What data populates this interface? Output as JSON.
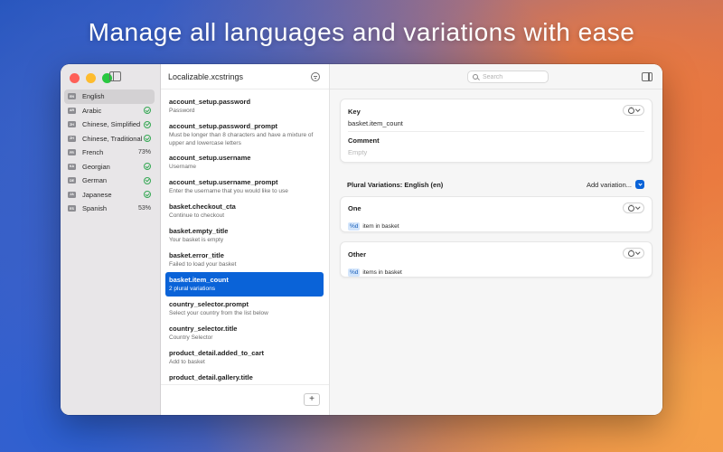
{
  "headline": "Manage all languages and variations with ease",
  "sidebar": {
    "languages": [
      {
        "code": "EN",
        "name": "English",
        "status": "",
        "complete": false,
        "selected": true
      },
      {
        "code": "AR",
        "name": "Arabic",
        "status": "",
        "complete": true
      },
      {
        "code": "ZH",
        "name": "Chinese, Simplified",
        "status": "",
        "complete": true
      },
      {
        "code": "ZH",
        "name": "Chinese, Traditional",
        "status": "",
        "complete": true
      },
      {
        "code": "FR",
        "name": "French",
        "status": "73%",
        "complete": false
      },
      {
        "code": "KA",
        "name": "Georgian",
        "status": "",
        "complete": true
      },
      {
        "code": "DE",
        "name": "German",
        "status": "",
        "complete": true
      },
      {
        "code": "JA",
        "name": "Japanese",
        "status": "",
        "complete": true
      },
      {
        "code": "ES",
        "name": "Spanish",
        "status": "53%",
        "complete": false
      }
    ]
  },
  "keylist": {
    "file_title": "Localizable.xcstrings",
    "add_label": "+",
    "keys": [
      {
        "name": "account_setup.password",
        "sub": "Password"
      },
      {
        "name": "account_setup.password_prompt",
        "sub": "Must be longer than 8 characters and have a mixture of upper and lowercase letters"
      },
      {
        "name": "account_setup.username",
        "sub": "Username"
      },
      {
        "name": "account_setup.username_prompt",
        "sub": "Enter the username that you would like to use"
      },
      {
        "name": "basket.checkout_cta",
        "sub": "Continue to checkout"
      },
      {
        "name": "basket.empty_title",
        "sub": "Your basket is empty"
      },
      {
        "name": "basket.error_title",
        "sub": "Failed to load your basket"
      },
      {
        "name": "basket.item_count",
        "sub": "2 plural variations"
      },
      {
        "name": "country_selector.prompt",
        "sub": "Select your country from the list below"
      },
      {
        "name": "country_selector.title",
        "sub": "Country Selector"
      },
      {
        "name": "product_detail.added_to_cart",
        "sub": "Add to basket"
      },
      {
        "name": "product_detail.gallery.title",
        "sub": ""
      }
    ]
  },
  "detail": {
    "search_placeholder": "Search",
    "key_label": "Key",
    "key_value": "basket.item_count",
    "comment_label": "Comment",
    "comment_placeholder": "Empty",
    "plural_title": "Plural Variations: English (en)",
    "add_variation_label": "Add variation...",
    "variations": [
      {
        "label": "One",
        "token": "%d",
        "text": "item in basket"
      },
      {
        "label": "Other",
        "token": "%d",
        "text": "items in basket"
      }
    ]
  },
  "colors": {
    "accent": "#0a63d8",
    "check": "#34a853"
  }
}
